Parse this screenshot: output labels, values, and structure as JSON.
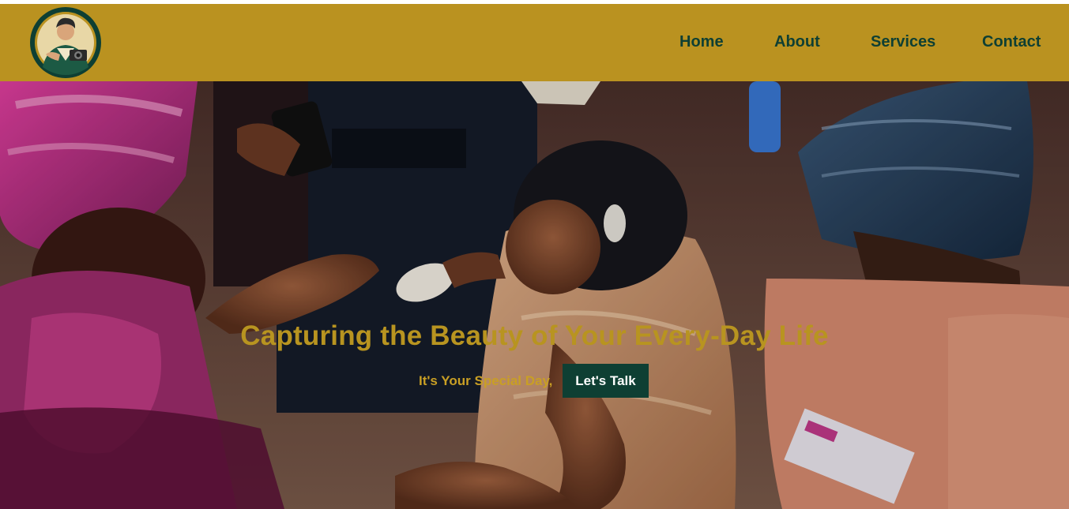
{
  "header": {
    "logo_icon": "photographer-logo-icon",
    "nav": {
      "home": "Home",
      "about": "About",
      "services": "Services",
      "contact": "Contact"
    }
  },
  "hero": {
    "title": "Capturing the Beauty of Your Every-Day Life",
    "subtitle": "It's Your Special Day,",
    "cta_label": "Let's Talk",
    "background": "wedding-celebration-photo"
  },
  "colors": {
    "header_bg": "#ba9220",
    "nav_text": "#0e3f33",
    "accent_gold": "#b89420",
    "button_bg": "#0e3f33",
    "button_text": "#ffffff"
  }
}
